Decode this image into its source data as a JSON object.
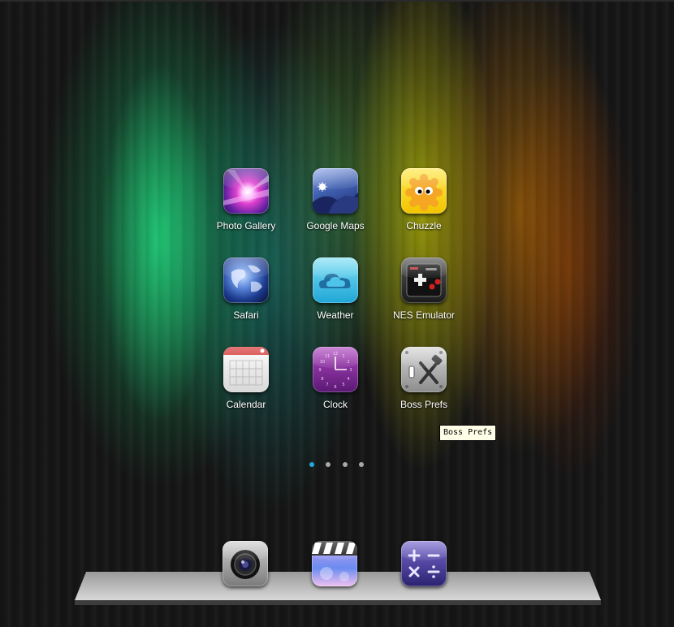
{
  "home_screen": {
    "apps": [
      {
        "label": "Photo Gallery",
        "icon": "photo-gallery-icon"
      },
      {
        "label": "Google Maps",
        "icon": "google-maps-icon"
      },
      {
        "label": "Chuzzle",
        "icon": "chuzzle-icon"
      },
      {
        "label": "Safari",
        "icon": "safari-globe-icon"
      },
      {
        "label": "Weather",
        "icon": "weather-cloud-icon"
      },
      {
        "label": "NES Emulator",
        "icon": "nes-controller-icon"
      },
      {
        "label": "Calendar",
        "icon": "calendar-icon"
      },
      {
        "label": "Clock",
        "icon": "clock-icon"
      },
      {
        "label": "Boss Prefs",
        "icon": "boss-prefs-tools-icon"
      }
    ],
    "tooltip": "Boss Prefs",
    "page_indicator": {
      "pages": 4,
      "current": 1
    },
    "dock": [
      {
        "icon": "camera-icon"
      },
      {
        "icon": "video-clapper-icon"
      },
      {
        "icon": "calculator-icon"
      }
    ]
  },
  "colors": {
    "background": "#151515",
    "active_dot": "#22a8e0",
    "inactive_dot": "#a8a8a8",
    "label_text": "#ffffff"
  }
}
